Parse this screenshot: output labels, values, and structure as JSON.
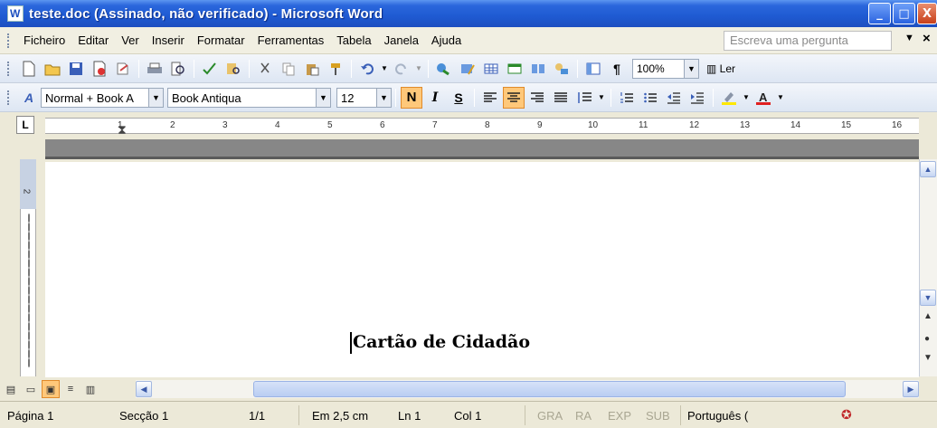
{
  "window": {
    "title": "teste.doc (Assinado, não verificado) - Microsoft Word",
    "controls": [
      "_",
      "□",
      "X"
    ]
  },
  "menu": {
    "items": [
      "Ficheiro",
      "Editar",
      "Ver",
      "Inserir",
      "Formatar",
      "Ferramentas",
      "Tabela",
      "Janela",
      "Ajuda"
    ],
    "help_placeholder": "Escreva uma pergunta",
    "close_doc": "×"
  },
  "standard_toolbar": {
    "icons": [
      "new-document-icon",
      "open-folder-icon",
      "save-icon",
      "permission-icon",
      "mail-icon",
      "print-icon",
      "print-preview-icon",
      "spelling-icon",
      "research-icon",
      "cut-icon",
      "copy-icon",
      "paste-icon",
      "format-painter-icon",
      "undo-icon",
      "redo-icon",
      "hyperlink-icon",
      "tables-borders-icon",
      "insert-table-icon",
      "insert-excel-icon",
      "columns-icon",
      "drawing-icon",
      "document-map-icon",
      "show-formatting-icon"
    ],
    "zoom": "100%",
    "read_label": "Ler"
  },
  "formatting_toolbar": {
    "style": "Normal + Book A",
    "font": "Book Antiqua",
    "size": "12",
    "bold_label": "N",
    "italic_label": "I",
    "underline_label": "S"
  },
  "ruler": {
    "numbers": [
      "1",
      "2",
      "3",
      "4",
      "5",
      "6",
      "7",
      "8",
      "9",
      "10",
      "11",
      "12",
      "13",
      "14",
      "15",
      "16"
    ],
    "tab_selector": "L",
    "vertical_number": "2"
  },
  "document": {
    "text": "Cartão de Cidadão"
  },
  "statusbar": {
    "page": "Página 1",
    "section": "Secção 1",
    "pages": "1/1",
    "at": "Em 2,5 cm",
    "line": "Ln 1",
    "col": "Col 1",
    "rec": "GRA",
    "trk": "RA",
    "ext": "EXP",
    "ovr": "SUB",
    "language": "Português ("
  },
  "colors": {
    "titlebar": "#1f5ad2",
    "active_button": "#ffc87a",
    "status_dim": "#a9a692"
  }
}
